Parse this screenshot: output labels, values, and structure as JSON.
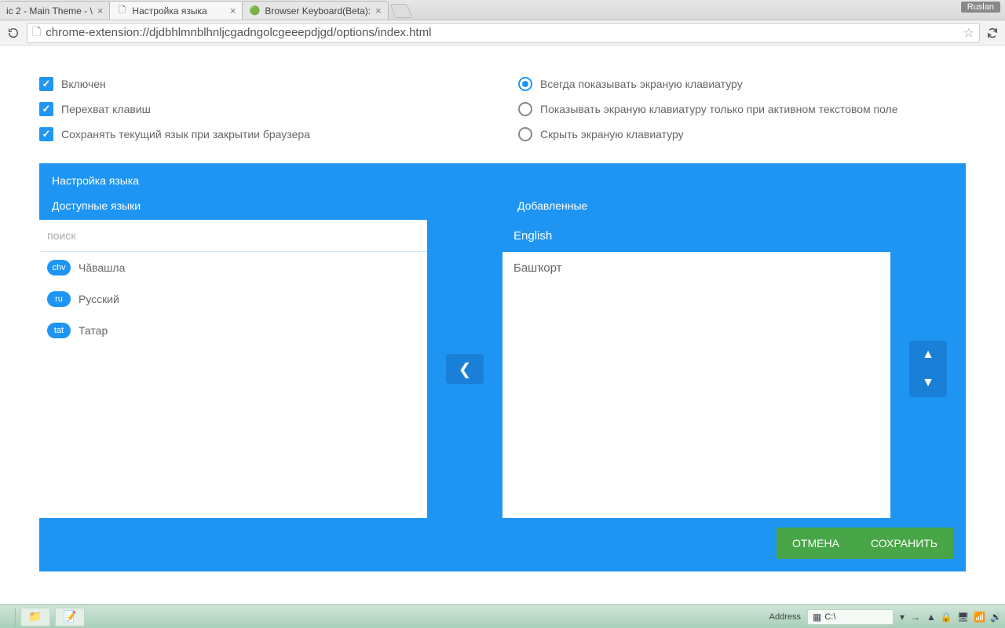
{
  "browser": {
    "tabs": [
      {
        "title": "ic 2 - Main Theme - \\",
        "active": false
      },
      {
        "title": "Настройка языка",
        "active": true
      },
      {
        "title": "Browser Keyboard(Beta): ",
        "active": false
      }
    ],
    "user_badge": "Ruslan",
    "url": "chrome-extension://djdbhlmnblhnljcgadngolcgeeepdjgd/options/index.html"
  },
  "settings": {
    "checkboxes": [
      {
        "label": "Включен",
        "checked": true
      },
      {
        "label": "Перехват клавиш",
        "checked": true
      },
      {
        "label": "Сохранять текущий язык при закрытии браузера",
        "checked": true
      }
    ],
    "radios": [
      {
        "label": "Всегда показывать экраную клавиатуру",
        "checked": true
      },
      {
        "label": "Показывать экраную клавиатуру только при активном текстовом поле",
        "checked": false
      },
      {
        "label": "Скрыть экраную клавиатуру",
        "checked": false
      }
    ]
  },
  "lang_panel": {
    "title": "Настройка языка",
    "available_header": "Доступные языки",
    "added_header": "Добавленные",
    "search_placeholder": "поиск",
    "available": [
      {
        "code": "chv",
        "name": "Чӑвашла"
      },
      {
        "code": "ru",
        "name": "Русский"
      },
      {
        "code": "tat",
        "name": "Татар"
      }
    ],
    "added": [
      {
        "name": "English",
        "selected": true
      },
      {
        "name": "Башҡорт",
        "selected": false
      }
    ],
    "buttons": {
      "cancel": "ОТМЕНА",
      "save": "СОХРАНИТЬ"
    }
  },
  "taskbar": {
    "address_label": "Address",
    "address_value": "C:\\"
  }
}
